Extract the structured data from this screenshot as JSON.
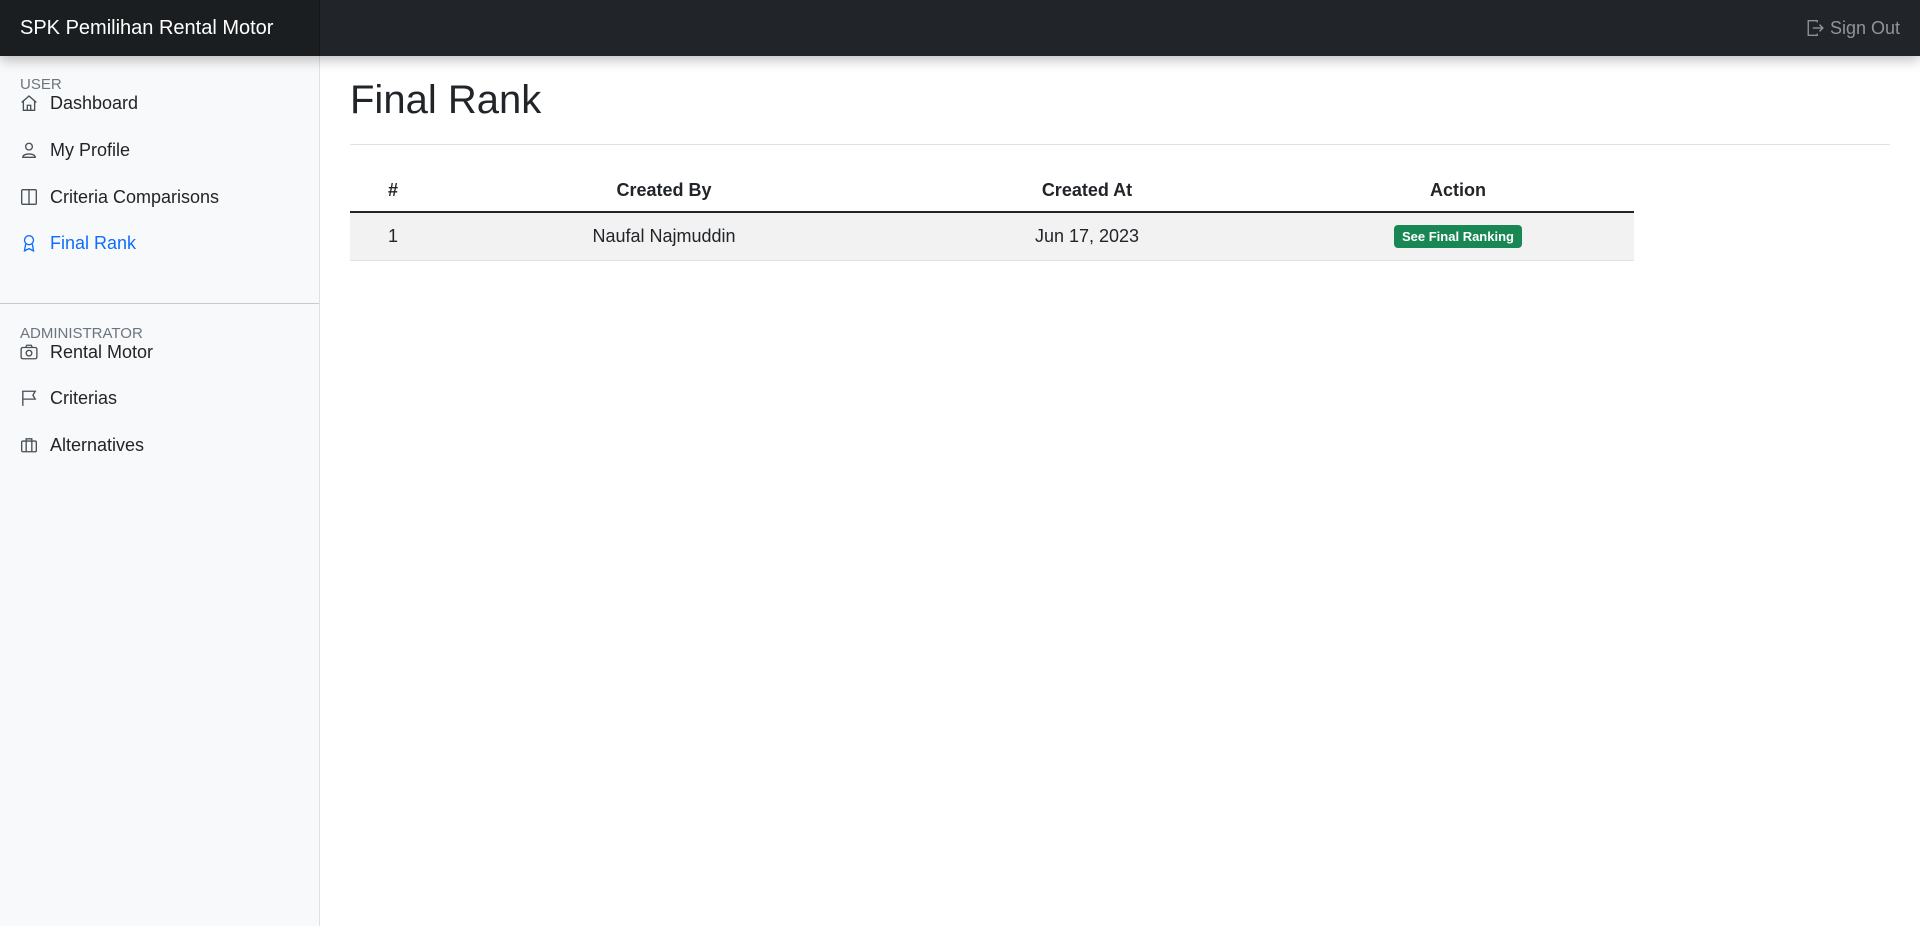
{
  "app": {
    "brand": "SPK Pemilihan Rental Motor"
  },
  "header": {
    "signout_label": "Sign Out"
  },
  "sidebar": {
    "sections": [
      {
        "heading": "USER",
        "items": [
          {
            "label": "Dashboard",
            "icon": "house-icon"
          },
          {
            "label": "My Profile",
            "icon": "person-icon"
          },
          {
            "label": "Criteria Comparisons",
            "icon": "layout-split-icon"
          },
          {
            "label": "Final Rank",
            "icon": "award-icon",
            "active": true
          }
        ]
      },
      {
        "heading": "ADMINISTRATOR",
        "items": [
          {
            "label": "Rental Motor",
            "icon": "camera-icon"
          },
          {
            "label": "Criterias",
            "icon": "flag-icon"
          },
          {
            "label": "Alternatives",
            "icon": "briefcase-icon"
          }
        ]
      }
    ]
  },
  "main": {
    "title": "Final Rank",
    "table": {
      "columns": [
        "#",
        "Created By",
        "Created At",
        "Action"
      ],
      "rows": [
        {
          "num": "1",
          "created_by": "Naufal Najmuddin",
          "created_at": "Jun 17, 2023",
          "action": "See Final Ranking"
        }
      ]
    }
  },
  "colors": {
    "navbar": "#212529",
    "active_link": "#0d6efd",
    "badge": "#198754",
    "sidebar_bg": "#f8f9fa"
  }
}
